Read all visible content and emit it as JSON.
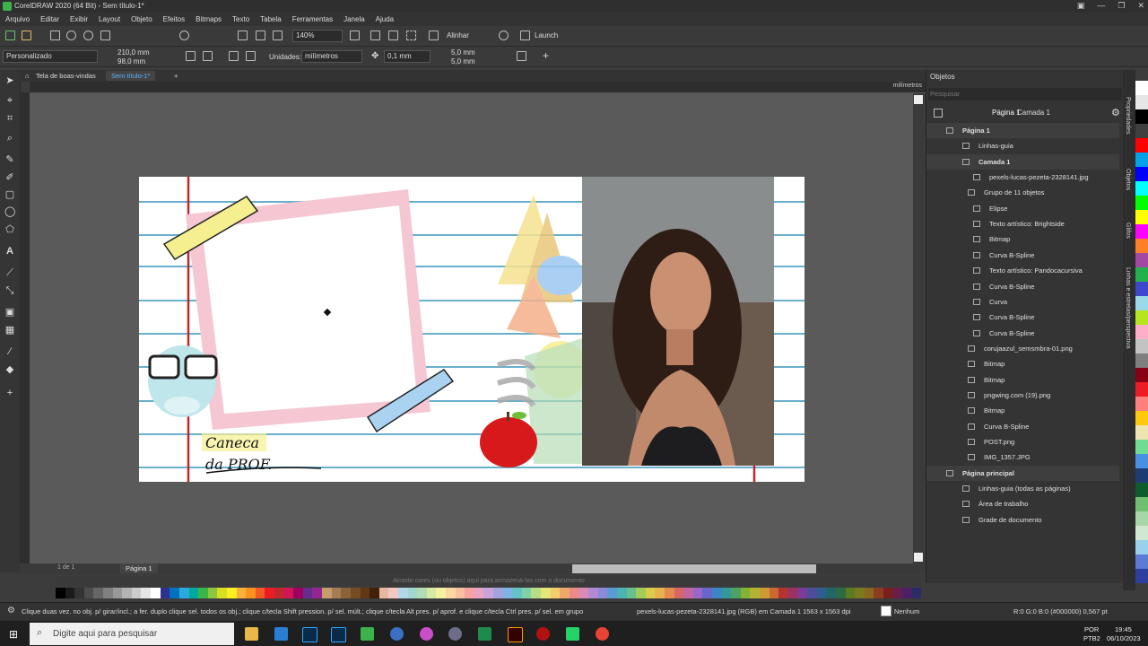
{
  "window": {
    "title": "CorelDRAW 2020 (64 Bit) - Sem título-1*",
    "buttons": [
      "▣",
      "—",
      "❐",
      "✕"
    ]
  },
  "menu": [
    "Arquivo",
    "Editar",
    "Exibir",
    "Layout",
    "Objeto",
    "Efeitos",
    "Bitmaps",
    "Texto",
    "Tabela",
    "Ferramentas",
    "Janela",
    "Ajuda"
  ],
  "toolbar": {
    "zoom": "140%",
    "align_label": "Alinhar",
    "launch_label": "Launch"
  },
  "property_bar": {
    "preset": "Personalizado",
    "width": "210,0 mm",
    "height": "98,0 mm",
    "units_label": "Unidades:",
    "units_value": "milímetros",
    "nudge": "0,1 mm",
    "dup_x": "5,0 mm",
    "dup_y": "5,0 mm"
  },
  "doc_tabs": {
    "welcome": "Tela de boas-vindas",
    "current": "Sem título-1*"
  },
  "ruler": {
    "unit": "milímetros"
  },
  "page_nav": {
    "counter": "1 de 1",
    "page_label": "Página 1"
  },
  "palette_hint": "Arraste cores (ou objetos) aqui para armazená-las com o documento",
  "palette_colors": [
    "#000000",
    "#1a1a1a",
    "#333333",
    "#4d4d4d",
    "#666666",
    "#808080",
    "#999999",
    "#b3b3b3",
    "#cccccc",
    "#e6e6e6",
    "#ffffff",
    "#2e3192",
    "#0071bc",
    "#29abe2",
    "#00a99d",
    "#39b54a",
    "#8cc63f",
    "#d9e021",
    "#fcee21",
    "#fbb03b",
    "#f7931e",
    "#f15a24",
    "#ed1c24",
    "#c1272d",
    "#d4145a",
    "#9e005d",
    "#662d91",
    "#93278f",
    "#c69c6d",
    "#a67c52",
    "#8c6239",
    "#754c24",
    "#603813",
    "#42210b",
    "#e6b8a2",
    "#f4c7c3",
    "#b0d7ea",
    "#a0d8cf",
    "#b4dcb3",
    "#d6e9a5",
    "#f6f1a0",
    "#fbd7a0",
    "#f8c0a0",
    "#f5a3a3",
    "#e9a3c3",
    "#c9a3d9",
    "#a3a3e0",
    "#7fb2e5",
    "#66c2c9",
    "#7fd1a8",
    "#b7de87",
    "#e6e57a",
    "#f2cf6b",
    "#f0a86a",
    "#ec8a8a",
    "#d98ab7",
    "#b38ad1",
    "#8a8ad6",
    "#5b9bd5",
    "#4db3b3",
    "#66c28a",
    "#a3cc5b",
    "#d9cc4d",
    "#e6b34d",
    "#e68a4d",
    "#d96666",
    "#c266a3",
    "#9966cc",
    "#6666cc",
    "#3d85c6",
    "#339999",
    "#4da366",
    "#85b333",
    "#b3b333",
    "#cc9933",
    "#cc6633",
    "#b33333",
    "#993366",
    "#7a3d99",
    "#4d4d99",
    "#2b5f91",
    "#226666",
    "#2d6b45",
    "#5c7a1f",
    "#7a7a1f",
    "#8a661f",
    "#8a3d1f",
    "#7a1f1f",
    "#661f4d",
    "#4d1f66",
    "#2b2b66"
  ],
  "right_palette": [
    "#ffffff",
    "#e6e6e6",
    "#000000",
    "#3f3f3f",
    "#ff0000",
    "#00a2e8",
    "#0000ff",
    "#00ffff",
    "#00ff00",
    "#ffff00",
    "#ff00ff",
    "#ff7f27",
    "#a349a4",
    "#22b14c",
    "#3f48cc",
    "#99d9ea",
    "#b5e61d",
    "#ffaec9",
    "#c3c3c3",
    "#7f7f7f",
    "#880015",
    "#ed1c24",
    "#ff7f7f",
    "#ffc90e",
    "#efe4b0",
    "#70db93",
    "#4a90e2",
    "#1f3b73",
    "#0d5c2e",
    "#6fbf73",
    "#a7d7a9",
    "#cfe8cf",
    "#9ad0ec",
    "#5b7bd5",
    "#2d3e9e"
  ],
  "objects_panel": {
    "title": "Objetos",
    "search_placeholder": "Pesquisar",
    "breadcrumb_page": "Página 1",
    "breadcrumb_layer": "Camada 1",
    "items": [
      {
        "label": "Página 1",
        "bold": true
      },
      {
        "label": "Linhas-guia"
      },
      {
        "label": "Camada 1",
        "bold": true
      },
      {
        "label": "pexels-lucas-pezeta-2328141.jpg"
      },
      {
        "label": "Grupo de 11 objetos"
      },
      {
        "label": "Elipse"
      },
      {
        "label": "Texto artístico: Brightside"
      },
      {
        "label": "Bitmap"
      },
      {
        "label": "Curva B-Spline"
      },
      {
        "label": "Texto artístico: Pandocacursiva"
      },
      {
        "label": "Curva B-Spline"
      },
      {
        "label": "Curva"
      },
      {
        "label": "Curva B-Spline"
      },
      {
        "label": "Curva B-Spline"
      },
      {
        "label": "corujaazul_semsmbra-01.png"
      },
      {
        "label": "Bitmap"
      },
      {
        "label": "Bitmap"
      },
      {
        "label": "pngwing.com (19).png"
      },
      {
        "label": "Bitmap"
      },
      {
        "label": "Curva B-Spline"
      },
      {
        "label": "POST.png"
      },
      {
        "label": "IMG_1357.JPG"
      },
      {
        "label": "Página principal",
        "bold": true
      },
      {
        "label": "Linhas-guia (todas as páginas)"
      },
      {
        "label": "Área de trabalho"
      },
      {
        "label": "Grade de documento"
      }
    ]
  },
  "side_tabs": [
    "Propriedades",
    "Objetos",
    "Glifos",
    "Linhas e estrelas/perspectiva"
  ],
  "artwork": {
    "logo_line1": "Caneca",
    "logo_line2": "da PROF."
  },
  "status": {
    "hint": "Clique duas vez. no obj. p/ girar/incl.; a fer. duplo clique sel. todos os obj.; clique c/tecla Shift pression. p/ sel. múlt.; clique c/tecla Alt pres. p/ aprof. e clique c/tecla Ctrl pres. p/ sel. em grupo",
    "object_info": "pexels-lucas-pezeta-2328141.jpg (RGB) em Camada 1 1563 x 1563 dpi",
    "fill": "Nenhum",
    "color": "R:0 G:0 B:0 (#000000)  0,567 pt"
  },
  "taskbar": {
    "search_placeholder": "Digite aqui para pesquisar",
    "lang": "POR",
    "lang2": "PTB2",
    "time": "19:45",
    "date": "06/10/2023"
  }
}
